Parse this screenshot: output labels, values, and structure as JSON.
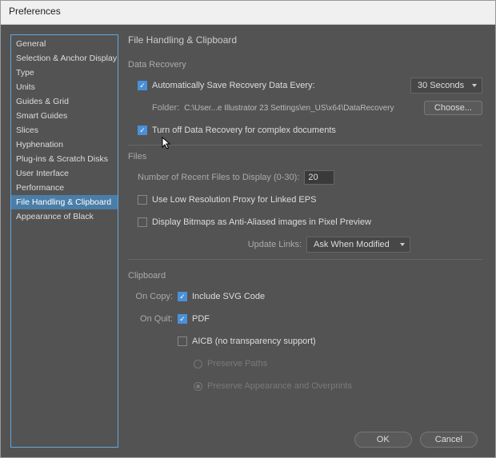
{
  "window": {
    "title": "Preferences"
  },
  "sidebar": {
    "items": [
      "General",
      "Selection & Anchor Display",
      "Type",
      "Units",
      "Guides & Grid",
      "Smart Guides",
      "Slices",
      "Hyphenation",
      "Plug-ins & Scratch Disks",
      "User Interface",
      "Performance",
      "File Handling & Clipboard",
      "Appearance of Black"
    ],
    "active_index": 11
  },
  "main": {
    "title": "File Handling & Clipboard",
    "data_recovery": {
      "label": "Data Recovery",
      "auto_save": {
        "checked": true,
        "label": "Automatically Save Recovery Data Every:"
      },
      "interval_value": "30 Seconds",
      "folder_label": "Folder:",
      "folder_path": "C:\\User...e Illustrator 23 Settings\\en_US\\x64\\DataRecovery",
      "choose_label": "Choose...",
      "turn_off": {
        "checked": true,
        "label": "Turn off Data Recovery for complex documents"
      }
    },
    "files": {
      "label": "Files",
      "recent_label": "Number of Recent Files to Display (0-30):",
      "recent_value": "20",
      "low_res": {
        "checked": false,
        "label": "Use Low Resolution Proxy for Linked EPS"
      },
      "bitmaps": {
        "checked": false,
        "label": "Display Bitmaps as Anti-Aliased images in Pixel Preview"
      },
      "update_links_label": "Update Links:",
      "update_links_value": "Ask When Modified"
    },
    "clipboard": {
      "label": "Clipboard",
      "on_copy_label": "On Copy:",
      "svg": {
        "checked": true,
        "label": "Include SVG Code"
      },
      "on_quit_label": "On Quit:",
      "pdf": {
        "checked": true,
        "label": "PDF"
      },
      "aicb": {
        "checked": false,
        "label": "AICB (no transparency support)"
      },
      "preserve_paths": {
        "selected": false,
        "label": "Preserve Paths"
      },
      "preserve_appearance": {
        "selected": true,
        "label": "Preserve Appearance and Overprints"
      }
    }
  },
  "footer": {
    "ok": "OK",
    "cancel": "Cancel"
  }
}
